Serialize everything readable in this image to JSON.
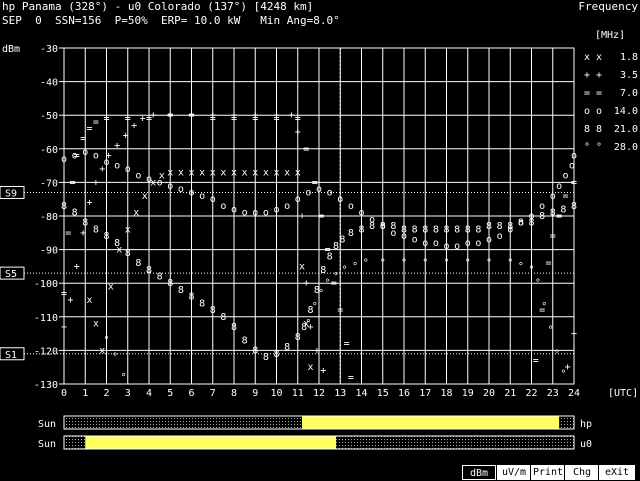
{
  "header": {
    "line1": "hp Panama (328°) - u0 Colorado (137°) [4248 km]",
    "line2": "SEP  0  SSN=156  P=50%  ERP= 10.0 kW   Min Ang=8.0°",
    "mode": "Frequency"
  },
  "menu": [
    {
      "label": "dBm",
      "active": true
    },
    {
      "label": "uV/m",
      "active": false
    },
    {
      "label": "Print",
      "active": false
    },
    {
      "label": "Chg",
      "active": false
    },
    {
      "label": "eXit",
      "active": false
    }
  ],
  "sun": {
    "label": "Sun",
    "rows": [
      {
        "station": "hp",
        "night_end_hour": 11.2,
        "night_start_hour": 23.3
      },
      {
        "station": "u0",
        "night_end_hour": 1.0,
        "night_start_hour": 12.8
      }
    ]
  },
  "colors": {
    "1.8": "#e8e8a0",
    "3.5": "#6060ff",
    "7.0": "#40e0e0",
    "14.0": "#ff40ff",
    "21.0": "#ff5a5a",
    "28.0": "#e8e8a0",
    "grid": "#ffffff",
    "sun_day": "#ffff60",
    "sun_night": "#808080"
  },
  "chart_data": {
    "type": "scatter",
    "ylabel": "dBm",
    "xlabel": "[UTC]",
    "legend_title": "[MHz]",
    "xlim": [
      0,
      24
    ],
    "ylim": [
      -130,
      -30
    ],
    "x_ticks": [
      0,
      1,
      2,
      3,
      4,
      5,
      6,
      7,
      8,
      9,
      10,
      11,
      12,
      13,
      14,
      15,
      16,
      17,
      18,
      19,
      20,
      21,
      22,
      23,
      24
    ],
    "y_ticks": [
      -30,
      -40,
      -50,
      -60,
      -70,
      -80,
      -90,
      -100,
      -110,
      -120,
      -130
    ],
    "s_markers": [
      {
        "label": "S9",
        "y": -73
      },
      {
        "label": "S5",
        "y": -97
      },
      {
        "label": "S1",
        "y": -121
      }
    ],
    "cursor_x": 13.0,
    "series": [
      {
        "name": "1.8",
        "marker": "x",
        "points": [
          [
            1.2,
            -105
          ],
          [
            1.5,
            -112
          ],
          [
            1.8,
            -120
          ],
          [
            2.2,
            -101
          ],
          [
            2.6,
            -90
          ],
          [
            3.0,
            -84
          ],
          [
            3.4,
            -79
          ],
          [
            3.8,
            -74
          ],
          [
            4.2,
            -70
          ],
          [
            4.6,
            -68
          ],
          [
            5.0,
            -67
          ],
          [
            5.5,
            -67
          ],
          [
            6.0,
            -67
          ],
          [
            6.5,
            -67
          ],
          [
            7.0,
            -67
          ],
          [
            7.5,
            -67
          ],
          [
            8.0,
            -67
          ],
          [
            8.5,
            -67
          ],
          [
            9.0,
            -67
          ],
          [
            9.5,
            -67
          ],
          [
            10.0,
            -67
          ],
          [
            10.5,
            -67
          ],
          [
            11.0,
            -67
          ],
          [
            11.2,
            -95
          ],
          [
            11.4,
            -112
          ],
          [
            11.6,
            -125
          ]
        ]
      },
      {
        "name": "3.5",
        "marker": "+",
        "points": [
          [
            0.0,
            -113
          ],
          [
            0.3,
            -105
          ],
          [
            0.6,
            -95
          ],
          [
            0.9,
            -85
          ],
          [
            1.2,
            -76
          ],
          [
            1.5,
            -70
          ],
          [
            1.8,
            -66
          ],
          [
            2.1,
            -62
          ],
          [
            2.5,
            -59
          ],
          [
            2.9,
            -56
          ],
          [
            3.3,
            -53
          ],
          [
            3.7,
            -51
          ],
          [
            4.2,
            -50
          ],
          [
            5.0,
            -50
          ],
          [
            6.0,
            -50
          ],
          [
            7.0,
            -50
          ],
          [
            8.0,
            -50
          ],
          [
            9.0,
            -50
          ],
          [
            10.0,
            -50
          ],
          [
            10.7,
            -50
          ],
          [
            11.0,
            -55
          ],
          [
            11.2,
            -80
          ],
          [
            11.4,
            -100
          ],
          [
            11.6,
            -113
          ],
          [
            11.9,
            -120
          ],
          [
            12.2,
            -126
          ],
          [
            23.7,
            -125
          ],
          [
            24.0,
            -115
          ]
        ]
      },
      {
        "name": "7.0",
        "marker": "=",
        "points": [
          [
            0.0,
            -103
          ],
          [
            0.2,
            -85
          ],
          [
            0.4,
            -70
          ],
          [
            0.6,
            -62
          ],
          [
            0.9,
            -57
          ],
          [
            1.2,
            -54
          ],
          [
            1.5,
            -52
          ],
          [
            2.0,
            -51
          ],
          [
            3.0,
            -51
          ],
          [
            4.0,
            -51
          ],
          [
            5.0,
            -50
          ],
          [
            6.0,
            -50
          ],
          [
            7.0,
            -51
          ],
          [
            8.0,
            -51
          ],
          [
            9.0,
            -51
          ],
          [
            10.0,
            -51
          ],
          [
            11.0,
            -51
          ],
          [
            11.4,
            -60
          ],
          [
            11.8,
            -70
          ],
          [
            12.1,
            -80
          ],
          [
            12.4,
            -90
          ],
          [
            12.7,
            -100
          ],
          [
            13.0,
            -108
          ],
          [
            13.3,
            -118
          ],
          [
            13.5,
            -128
          ],
          [
            22.2,
            -123
          ],
          [
            22.5,
            -108
          ],
          [
            22.8,
            -94
          ],
          [
            23.0,
            -86
          ],
          [
            23.3,
            -80
          ],
          [
            23.6,
            -74
          ],
          [
            24.0,
            -70
          ]
        ]
      },
      {
        "name": "14.0",
        "marker": "o",
        "points": [
          [
            0.0,
            -63
          ],
          [
            0.5,
            -62
          ],
          [
            1.0,
            -61
          ],
          [
            1.5,
            -62
          ],
          [
            2.0,
            -64
          ],
          [
            2.5,
            -65
          ],
          [
            3.0,
            -66
          ],
          [
            3.5,
            -68
          ],
          [
            4.0,
            -69
          ],
          [
            4.5,
            -70
          ],
          [
            5.0,
            -71
          ],
          [
            5.5,
            -72
          ],
          [
            6.0,
            -73
          ],
          [
            6.5,
            -74
          ],
          [
            7.0,
            -75
          ],
          [
            7.5,
            -77
          ],
          [
            8.0,
            -78
          ],
          [
            8.5,
            -79
          ],
          [
            9.0,
            -79
          ],
          [
            9.5,
            -79
          ],
          [
            10.0,
            -78
          ],
          [
            10.5,
            -77
          ],
          [
            11.0,
            -75
          ],
          [
            11.5,
            -73
          ],
          [
            12.0,
            -72
          ],
          [
            12.5,
            -73
          ],
          [
            13.0,
            -75
          ],
          [
            13.5,
            -77
          ],
          [
            14.0,
            -79
          ],
          [
            14.5,
            -81
          ],
          [
            15.0,
            -83
          ],
          [
            15.5,
            -85
          ],
          [
            16.0,
            -86
          ],
          [
            16.5,
            -87
          ],
          [
            17.0,
            -88
          ],
          [
            17.5,
            -88
          ],
          [
            18.0,
            -89
          ],
          [
            18.5,
            -89
          ],
          [
            19.0,
            -88
          ],
          [
            19.5,
            -88
          ],
          [
            20.0,
            -87
          ],
          [
            20.5,
            -86
          ],
          [
            21.0,
            -84
          ],
          [
            21.5,
            -82
          ],
          [
            22.0,
            -80
          ],
          [
            22.5,
            -77
          ],
          [
            23.0,
            -74
          ],
          [
            23.3,
            -71
          ],
          [
            23.6,
            -68
          ],
          [
            23.9,
            -65
          ],
          [
            24.0,
            -62
          ]
        ]
      },
      {
        "name": "21.0",
        "marker": "8",
        "points": [
          [
            0.0,
            -77
          ],
          [
            0.5,
            -79
          ],
          [
            1.0,
            -82
          ],
          [
            1.5,
            -84
          ],
          [
            2.0,
            -86
          ],
          [
            2.5,
            -88
          ],
          [
            3.0,
            -91
          ],
          [
            3.5,
            -94
          ],
          [
            4.0,
            -96
          ],
          [
            4.5,
            -98
          ],
          [
            5.0,
            -100
          ],
          [
            5.5,
            -102
          ],
          [
            6.0,
            -104
          ],
          [
            6.5,
            -106
          ],
          [
            7.0,
            -108
          ],
          [
            7.5,
            -110
          ],
          [
            8.0,
            -113
          ],
          [
            8.5,
            -117
          ],
          [
            9.0,
            -120
          ],
          [
            9.5,
            -122
          ],
          [
            10.0,
            -121
          ],
          [
            10.5,
            -119
          ],
          [
            11.0,
            -116
          ],
          [
            11.3,
            -113
          ],
          [
            11.6,
            -108
          ],
          [
            11.9,
            -102
          ],
          [
            12.2,
            -96
          ],
          [
            12.5,
            -92
          ],
          [
            12.8,
            -89
          ],
          [
            13.1,
            -87
          ],
          [
            13.5,
            -85
          ],
          [
            14.0,
            -84
          ],
          [
            14.5,
            -83
          ],
          [
            15.0,
            -83
          ],
          [
            15.5,
            -83
          ],
          [
            16.0,
            -84
          ],
          [
            16.5,
            -84
          ],
          [
            17.0,
            -84
          ],
          [
            17.5,
            -84
          ],
          [
            18.0,
            -84
          ],
          [
            18.5,
            -84
          ],
          [
            19.0,
            -84
          ],
          [
            19.5,
            -84
          ],
          [
            20.0,
            -83
          ],
          [
            20.5,
            -83
          ],
          [
            21.0,
            -83
          ],
          [
            21.5,
            -82
          ],
          [
            22.0,
            -82
          ],
          [
            22.5,
            -80
          ],
          [
            23.0,
            -79
          ],
          [
            23.5,
            -78
          ],
          [
            24.0,
            -77
          ]
        ]
      },
      {
        "name": "28.0",
        "marker": "°",
        "points": [
          [
            2.0,
            -117
          ],
          [
            2.4,
            -122
          ],
          [
            2.8,
            -128
          ],
          [
            11.5,
            -112
          ],
          [
            11.8,
            -107
          ],
          [
            12.1,
            -103
          ],
          [
            12.4,
            -100
          ],
          [
            12.8,
            -98
          ],
          [
            13.2,
            -96
          ],
          [
            13.7,
            -95
          ],
          [
            14.2,
            -94
          ],
          [
            15.0,
            -94
          ],
          [
            16.0,
            -94
          ],
          [
            17.0,
            -94
          ],
          [
            18.0,
            -94
          ],
          [
            19.0,
            -94
          ],
          [
            20.0,
            -94
          ],
          [
            21.0,
            -94
          ],
          [
            21.5,
            -95
          ],
          [
            22.0,
            -96
          ],
          [
            22.3,
            -100
          ],
          [
            22.6,
            -107
          ],
          [
            22.9,
            -114
          ],
          [
            23.2,
            -121
          ],
          [
            23.5,
            -127
          ]
        ]
      }
    ]
  }
}
